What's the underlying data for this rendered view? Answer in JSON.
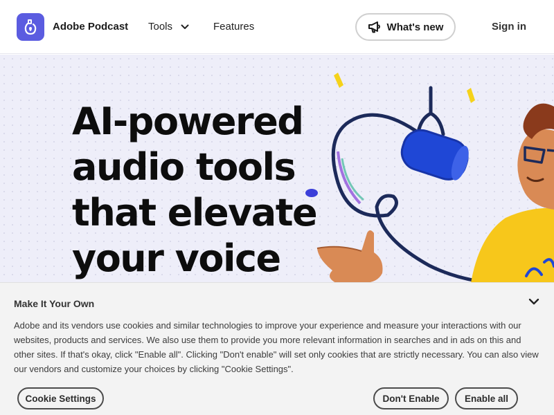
{
  "header": {
    "brand": "Adobe Podcast",
    "logo_icon": "podcast-logo-icon",
    "nav": {
      "tools_label": "Tools",
      "features_label": "Features"
    },
    "whats_new_label": "What's new",
    "sign_in_label": "Sign in"
  },
  "hero": {
    "title_lines": [
      "AI-powered",
      "audio tools",
      "that elevate",
      "your voice"
    ],
    "illustration": "microphone-person-illustration"
  },
  "cookie_banner": {
    "title": "Make It Your Own",
    "body": "Adobe and its vendors use cookies and similar technologies to improve your experience and measure your interactions with our websites, products and services. We also use them to provide you more relevant information in searches and in ads on this and other sites. If that's okay, click \"Enable all\". Clicking \"Don't enable\" will set only cookies that are strictly necessary. You can also view our vendors and customize your choices by clicking \"Cookie Settings\".",
    "cookie_settings_label": "Cookie Settings",
    "dont_enable_label": "Don't Enable",
    "enable_all_label": "Enable all"
  },
  "colors": {
    "logo_bg": "#5b5ce0",
    "hero_bg": "#eeeef9",
    "mic_blue": "#1f47d6",
    "shirt_yellow": "#f7c71b",
    "skin": "#d98a55",
    "cable": "#1c2a5a"
  }
}
